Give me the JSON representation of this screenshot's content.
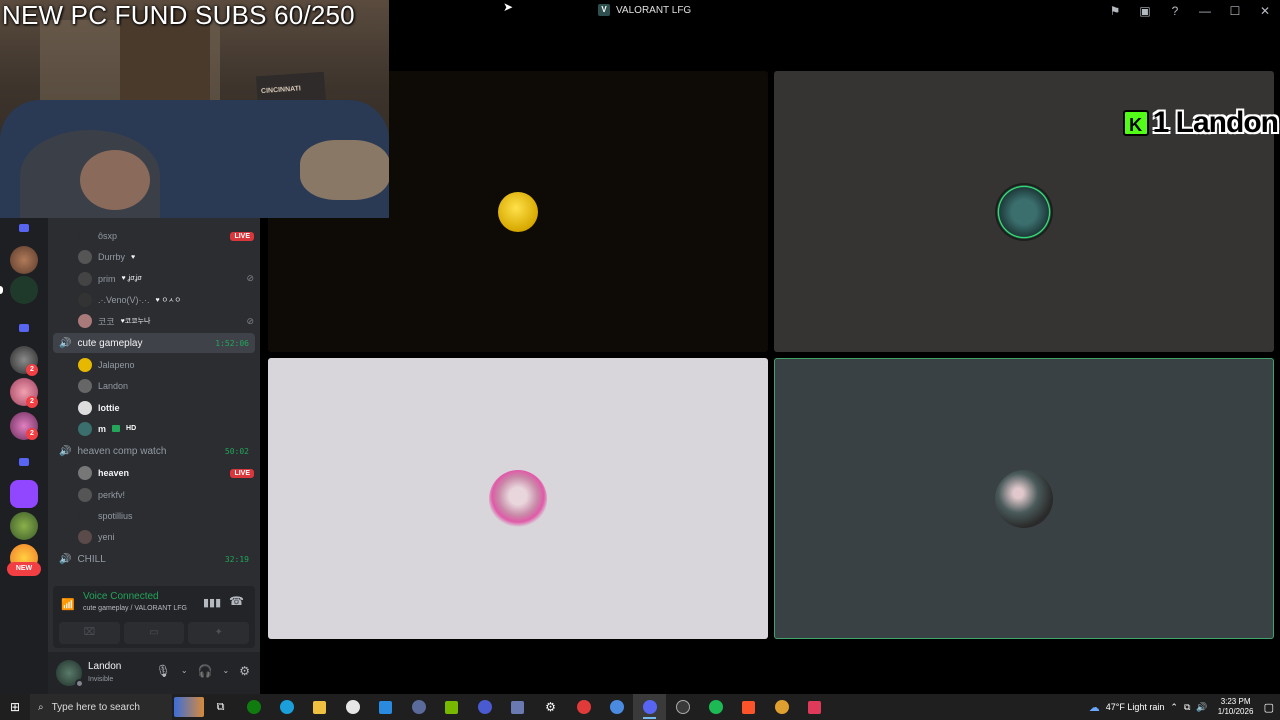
{
  "overlay": {
    "stream_title": "NEW PC FUND SUBS 60/250",
    "poster_text": "CINCINNATI"
  },
  "window": {
    "title": "VALORANT LFG",
    "app_glyph": "V"
  },
  "rail": {
    "new_label": "NEW",
    "badges": [
      "2",
      "2",
      "2"
    ]
  },
  "channels": {
    "top_users": [
      {
        "name": "ôsxp",
        "live": "LIVE",
        "avatar_color": "#2b2d31"
      },
      {
        "name": "Durrby",
        "suffix": "♥",
        "avatar_color": "#555"
      },
      {
        "name": "prim",
        "suffix": "♥ ʝσʝσ",
        "avatar_color": "#444",
        "muted": true
      },
      {
        "name": ".·.Veno(V)·.·.",
        "suffix": "♥ ㅇㅅㅇ",
        "avatar_color": "#333"
      },
      {
        "name": "코코",
        "suffix": "♥코코누나",
        "avatar_color": "#a87a7a",
        "muted": true
      }
    ],
    "voice_channels": [
      {
        "name": "cute gameplay",
        "timer": "1:52:06",
        "active": true,
        "users": [
          {
            "name": "Jalapeno",
            "avatar_color": "#e6b800",
            "bold": false
          },
          {
            "name": "Landon",
            "avatar_color": "#666",
            "bold": false
          },
          {
            "name": "lottie",
            "avatar_color": "#ddd",
            "bold": true
          },
          {
            "name": "m",
            "avatar_color": "#3a6f6e",
            "bold": true,
            "hd": "HD"
          }
        ]
      },
      {
        "name": "heaven comp watch",
        "timer": "50:02",
        "active": false,
        "users": [
          {
            "name": "heaven",
            "avatar_color": "#777",
            "bold": true,
            "live": "LIVE"
          },
          {
            "name": "perkfv!",
            "avatar_color": "#555",
            "bold": false
          },
          {
            "name": "spotillius",
            "avatar_color": "#2b2d31",
            "bold": false
          },
          {
            "name": "yeni",
            "avatar_color": "#5a4a4a",
            "bold": false
          }
        ]
      },
      {
        "name": "CHILL",
        "timer": "32:19",
        "active": false,
        "users": []
      }
    ]
  },
  "voice": {
    "status": "Voice Connected",
    "location": "cute gameplay / VALORANT LFG"
  },
  "user": {
    "name": "Landon",
    "status": "Invisible"
  },
  "stage": {
    "landon_tag": "1 Landon",
    "k_logo": "K"
  },
  "taskbar": {
    "search_placeholder": "Type here to search",
    "weather": "47°F  Light rain",
    "time": "3:23 PM",
    "date": "1/10/2026",
    "task_view_badge": "18"
  },
  "colors": {
    "discord_green": "#23a55a",
    "live_red": "#da373c",
    "kick_green": "#53fc18",
    "accent_blurple": "#5865f2"
  }
}
